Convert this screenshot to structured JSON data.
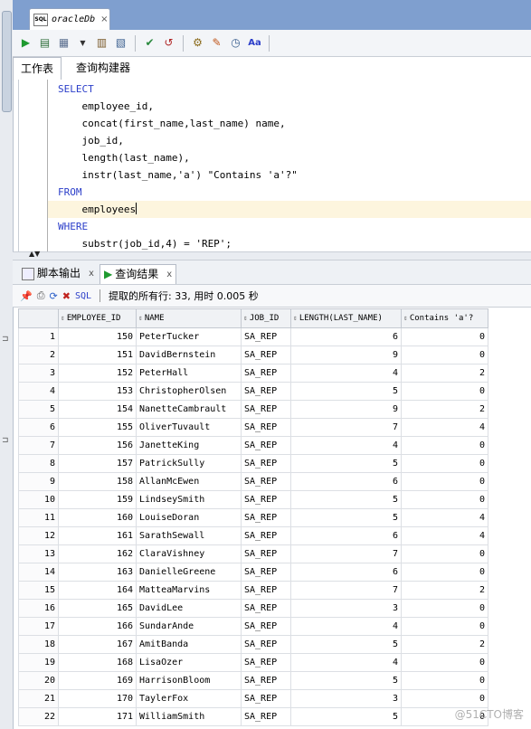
{
  "tab": {
    "title": "oracleDb",
    "icon": "sql-file-icon"
  },
  "toolbar": {
    "buttons": [
      "run-statement-icon",
      "run-script-icon",
      "commit-icon",
      "rollback-icon",
      "explain-plan-icon",
      "autotrace-icon",
      "clear-icon",
      "sql-tuning-icon",
      "format-icon",
      "history-icon",
      "case-icon"
    ]
  },
  "editor_tabs": {
    "worksheet": "工作表",
    "query_builder": "查询构建器"
  },
  "sql": {
    "lines": [
      "SELECT",
      "    employee_id,",
      "    concat(first_name,last_name) name,",
      "    job_id,",
      "    length(last_name),",
      "    instr(last_name,'a') \"Contains 'a'?\"",
      "FROM",
      "    employees",
      "WHERE",
      "    substr(job_id,4) = 'REP';"
    ]
  },
  "result_tabs": {
    "script_output": "脚本输出",
    "query_result": "查询结果",
    "close": "x"
  },
  "result_toolbar": {
    "sql_label": "SQL",
    "status": "提取的所有行: 33, 用时 0.005 秒"
  },
  "grid": {
    "columns": [
      "EMPLOYEE_ID",
      "NAME",
      "JOB_ID",
      "LENGTH(LAST_NAME)",
      "Contains 'a'?"
    ],
    "rows": [
      [
        "1",
        "150",
        "PeterTucker",
        "SA_REP",
        "6",
        "0"
      ],
      [
        "2",
        "151",
        "DavidBernstein",
        "SA_REP",
        "9",
        "0"
      ],
      [
        "3",
        "152",
        "PeterHall",
        "SA_REP",
        "4",
        "2"
      ],
      [
        "4",
        "153",
        "ChristopherOlsen",
        "SA_REP",
        "5",
        "0"
      ],
      [
        "5",
        "154",
        "NanetteCambrault",
        "SA_REP",
        "9",
        "2"
      ],
      [
        "6",
        "155",
        "OliverTuvault",
        "SA_REP",
        "7",
        "4"
      ],
      [
        "7",
        "156",
        "JanetteKing",
        "SA_REP",
        "4",
        "0"
      ],
      [
        "8",
        "157",
        "PatrickSully",
        "SA_REP",
        "5",
        "0"
      ],
      [
        "9",
        "158",
        "AllanMcEwen",
        "SA_REP",
        "6",
        "0"
      ],
      [
        "10",
        "159",
        "LindseySmith",
        "SA_REP",
        "5",
        "0"
      ],
      [
        "11",
        "160",
        "LouiseDoran",
        "SA_REP",
        "5",
        "4"
      ],
      [
        "12",
        "161",
        "SarathSewall",
        "SA_REP",
        "6",
        "4"
      ],
      [
        "13",
        "162",
        "ClaraVishney",
        "SA_REP",
        "7",
        "0"
      ],
      [
        "14",
        "163",
        "DanielleGreene",
        "SA_REP",
        "6",
        "0"
      ],
      [
        "15",
        "164",
        "MatteaMarvins",
        "SA_REP",
        "7",
        "2"
      ],
      [
        "16",
        "165",
        "DavidLee",
        "SA_REP",
        "3",
        "0"
      ],
      [
        "17",
        "166",
        "SundarAnde",
        "SA_REP",
        "4",
        "0"
      ],
      [
        "18",
        "167",
        "AmitBanda",
        "SA_REP",
        "5",
        "2"
      ],
      [
        "19",
        "168",
        "LisaOzer",
        "SA_REP",
        "4",
        "0"
      ],
      [
        "20",
        "169",
        "HarrisonBloom",
        "SA_REP",
        "5",
        "0"
      ],
      [
        "21",
        "170",
        "TaylerFox",
        "SA_REP",
        "3",
        "0"
      ],
      [
        "22",
        "171",
        "WilliamSmith",
        "SA_REP",
        "5",
        "0"
      ]
    ]
  },
  "watermark": "@51CTO博客",
  "colors": {
    "topbar": "#7f9fcf",
    "keyword": "#2b3ec9",
    "current_line": "#fdf5de"
  }
}
